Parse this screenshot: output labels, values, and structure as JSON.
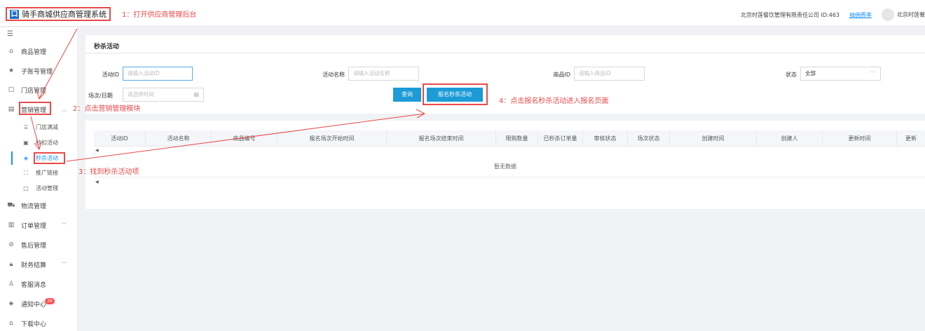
{
  "header": {
    "logo_glyph": "口",
    "app_title": "骑手商城供应商管理系统",
    "company": "北京时莲餐饮管理有限责任公司 ID:463",
    "rate_link": "抽佣费率",
    "user_name": "北京时莲餐"
  },
  "sidebar": {
    "toggle_icon": "hamburger-icon",
    "items": [
      {
        "label": "商品管理",
        "icon": "home-icon"
      },
      {
        "label": "子账号管理",
        "icon": "star-icon"
      },
      {
        "label": "门店管理",
        "icon": "square-icon"
      },
      {
        "label": "营销管理",
        "icon": "calendar-icon",
        "expanded": true
      },
      {
        "label": "物流管理",
        "icon": "truck-icon"
      },
      {
        "label": "订单管理",
        "icon": "clipboard-icon"
      },
      {
        "label": "售后管理",
        "icon": "check-circle-icon"
      },
      {
        "label": "财务结算",
        "icon": "lock-icon"
      },
      {
        "label": "客服消息",
        "icon": "user-icon"
      },
      {
        "label": "通知中心",
        "icon": "speaker-icon",
        "badge": "26"
      },
      {
        "label": "下载中心",
        "icon": "home-icon"
      }
    ],
    "marketing_sub": [
      {
        "label": "门店满减",
        "icon": "ticket-icon"
      },
      {
        "label": "秒扣活动",
        "icon": "image-icon"
      },
      {
        "label": "秒杀活动",
        "icon": "speaker-icon",
        "active": true
      },
      {
        "label": "推广链接",
        "icon": "scan-icon"
      },
      {
        "label": "活动管理",
        "icon": "square-icon"
      }
    ]
  },
  "page": {
    "title": "秒杀活动",
    "filters": {
      "activity_id_label": "活动ID",
      "activity_id_placeholder": "请输入活动ID",
      "activity_name_label": "活动名称",
      "activity_name_placeholder": "请输入活动名称",
      "product_id_label": "商品ID",
      "product_id_placeholder": "请输入商品ID",
      "status_label": "状态",
      "status_value": "全部",
      "date_label": "场次/日期",
      "date_placeholder": "请选择时间"
    },
    "buttons": {
      "search": "查询",
      "register": "报名秒杀活动"
    },
    "table": {
      "columns": [
        "活动ID",
        "活动名称",
        "商品编号",
        "报名场次开始时间",
        "报名场次结束时间",
        "限购数量",
        "已秒杀订单量",
        "审核状态",
        "场次状态",
        "创建时间",
        "创建人",
        "更新时间",
        "更新"
      ],
      "empty_text": "暂无数据"
    }
  },
  "annotations": {
    "step1": "1：打开供应商管理后台",
    "step2": "2：点击营销管理模块",
    "step3": "3：找到秒杀活动项",
    "step4": "4：点击报名秒杀活动进入报名页面",
    "color": "#e84a4a"
  },
  "colors": {
    "primary_button": "#1c9bd7",
    "active_menu": "#1890ff",
    "badge": "#ff4d4f"
  }
}
